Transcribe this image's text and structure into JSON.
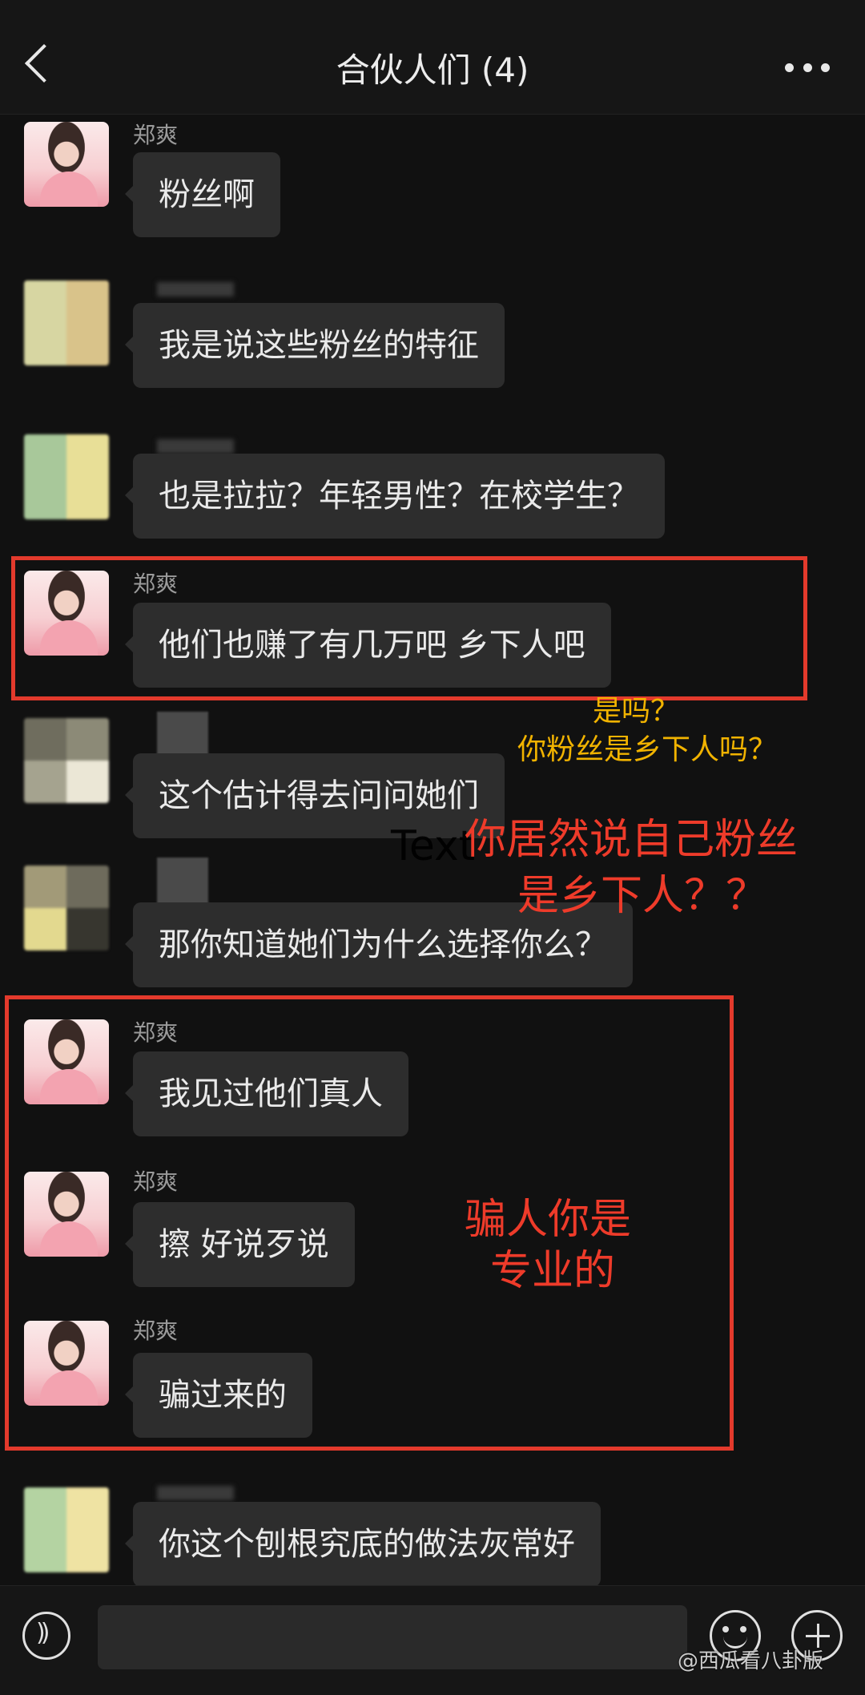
{
  "header": {
    "title": "合伙人们 (4)"
  },
  "messages": [
    {
      "sender": "郑爽",
      "text": "粉丝啊"
    },
    {
      "sender": "",
      "text": "我是说这些粉丝的特征"
    },
    {
      "sender": "",
      "text": "也是拉拉？年轻男性？在校学生？"
    },
    {
      "sender": "郑爽",
      "text": "他们也赚了有几万吧 乡下人吧"
    },
    {
      "sender": "",
      "text": "这个估计得去问问她们"
    },
    {
      "sender": "",
      "text": "那你知道她们为什么选择你么？"
    },
    {
      "sender": "郑爽",
      "text": "我见过他们真人"
    },
    {
      "sender": "郑爽",
      "text": "擦 好说歹说"
    },
    {
      "sender": "郑爽",
      "text": "骗过来的"
    },
    {
      "sender": "",
      "text": "你这个刨根究底的做法灰常好"
    }
  ],
  "annotations": {
    "yellow_line1": "是吗？",
    "yellow_line2": "你粉丝是乡下人吗？",
    "red_line1": "你居然说自己粉丝",
    "red_line2": "是乡下人？？",
    "red_line3": "骗人你是",
    "red_line4": "专业的",
    "ghost_text": "Text"
  },
  "watermark": "@西瓜看八卦版",
  "colors": {
    "annotation_red": "#ee3b2a",
    "annotation_yellow": "#f1b300",
    "bubble": "#2d2d2d",
    "background": "#111111"
  }
}
